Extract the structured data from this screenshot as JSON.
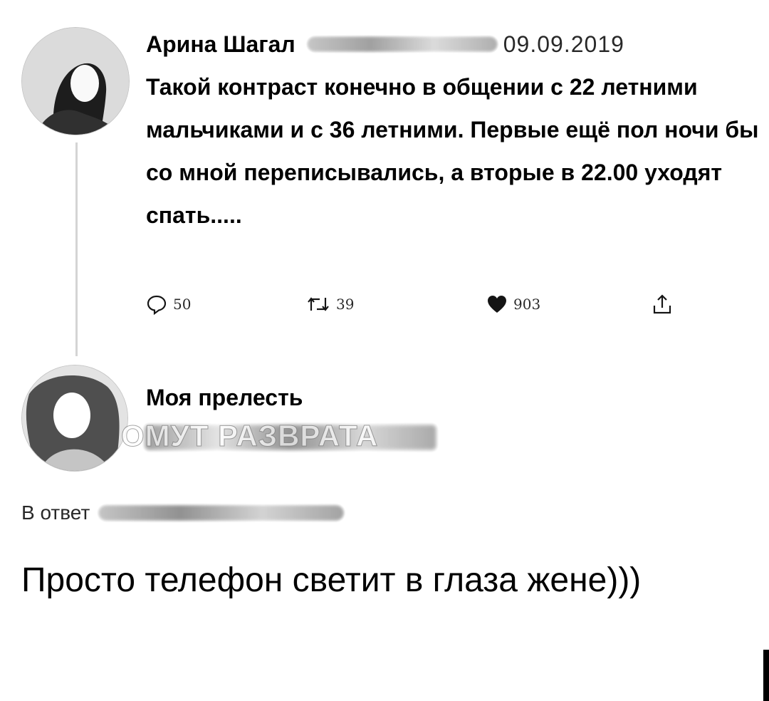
{
  "original_tweet": {
    "author_name": "Арина Шагал",
    "date": "09.09.2019",
    "text": "Такой контраст конечно в общении с 22 летними мальчиками и с 36 летними. Первые ещё пол ночи бы со мной переписывались, а вторые в 22.00 уходят спать.....",
    "stats": {
      "replies": "50",
      "retweets": "39",
      "likes": "903"
    },
    "icons": {
      "reply": "reply-icon",
      "retweet": "retweet-icon",
      "like": "heart-icon",
      "share": "share-icon"
    }
  },
  "reply_tweet": {
    "author_name": "Моя прелесть",
    "watermark": "ОМУТ РАЗВРАТА",
    "reply_to_label": "В ответ",
    "text": "Просто телефон светит в глаза жене)))"
  }
}
